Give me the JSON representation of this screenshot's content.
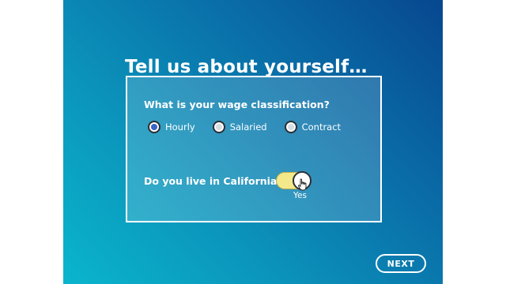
{
  "title": "Tell us about yourself…",
  "wage": {
    "question": "What is your wage classification?",
    "options": [
      {
        "label": "Hourly",
        "checked": true
      },
      {
        "label": "Salaried",
        "checked": false
      },
      {
        "label": "Contract",
        "checked": false
      }
    ]
  },
  "california": {
    "question": "Do you live in California?",
    "toggle_state": "Yes",
    "toggle_on": true
  },
  "next_label": "NEXT",
  "colors": {
    "gradient_top_right": "#07478f",
    "gradient_bottom_left": "#0ab5cc",
    "toggle_fill": "#f4e98a",
    "radio_selected": "#3b63c4"
  }
}
